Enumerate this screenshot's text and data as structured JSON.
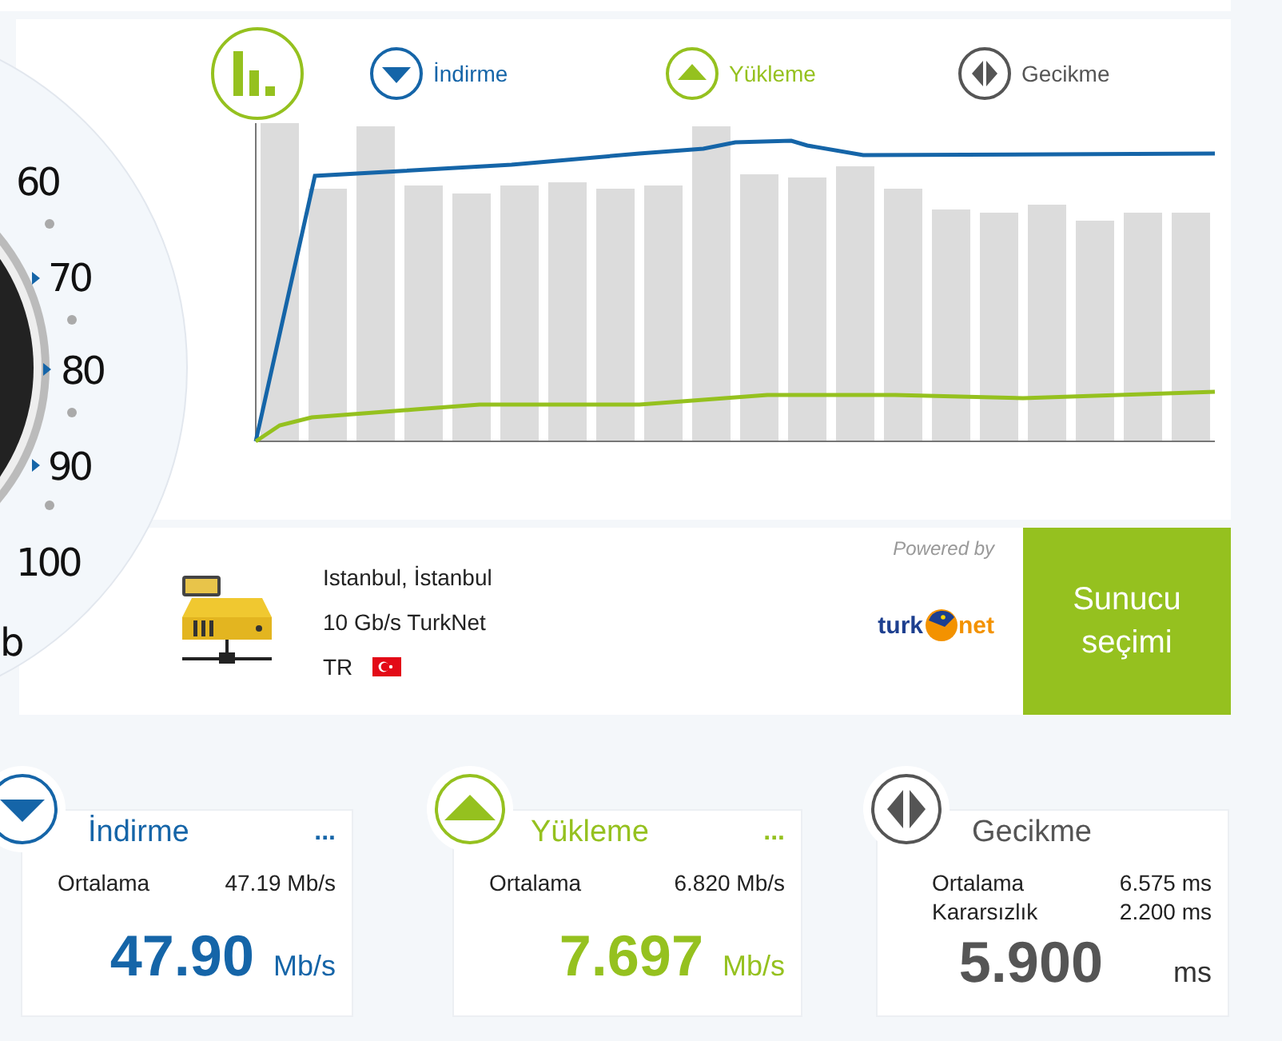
{
  "gauge": {
    "labels": [
      "60",
      "70",
      "80",
      "90",
      "100"
    ],
    "unit": "b"
  },
  "chart": {
    "legend": [
      {
        "kind": "download",
        "label": "İndirme"
      },
      {
        "kind": "upload",
        "label": "Yükleme"
      },
      {
        "kind": "latency",
        "label": "Gecikme"
      }
    ]
  },
  "server": {
    "location": "Istanbul, İstanbul",
    "name": "10 Gb/s TurkNet",
    "country": "TR",
    "powered_by": "Powered by",
    "logo": [
      "turk",
      "net"
    ]
  },
  "select_button": "Sunucu seçimi",
  "results": [
    {
      "kind": "download",
      "title": "İndirme",
      "menu": "...",
      "stats": [
        {
          "label": "Ortalama",
          "value": "47.19 Mb/s"
        }
      ],
      "value": "47.90",
      "unit": "Mb/s"
    },
    {
      "kind": "upload",
      "title": "Yükleme",
      "menu": "...",
      "stats": [
        {
          "label": "Ortalama",
          "value": "6.820 Mb/s"
        }
      ],
      "value": "7.697",
      "unit": "Mb/s"
    },
    {
      "kind": "latency",
      "title": "Gecikme",
      "stats": [
        {
          "label": "Ortalama",
          "value": "6.575 ms"
        },
        {
          "label": "Kararsızlık",
          "value": "2.200 ms"
        }
      ],
      "value": "5.900",
      "unit": "ms"
    }
  ]
}
